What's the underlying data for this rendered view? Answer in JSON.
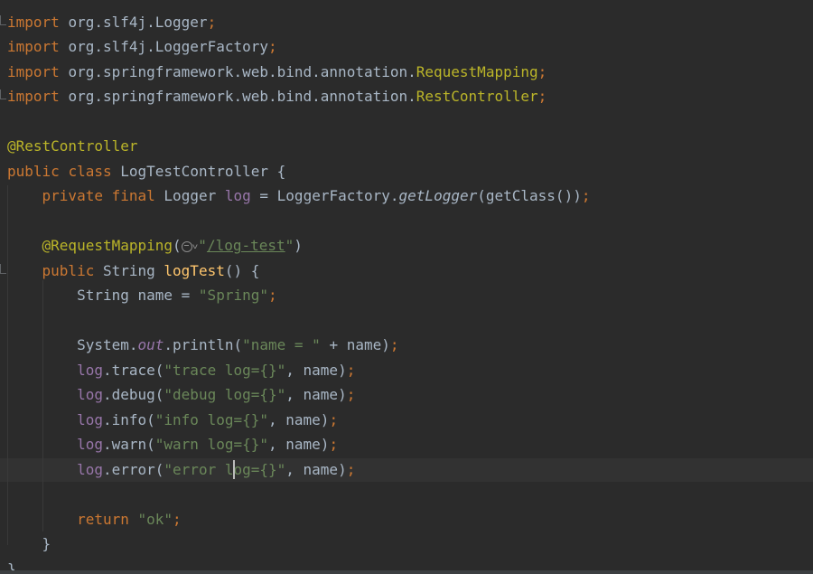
{
  "code": {
    "imports": [
      {
        "keyword": "import",
        "path": "org.slf4j.",
        "cls": "Logger",
        "semi": ";"
      },
      {
        "keyword": "import",
        "path": "org.slf4j.",
        "cls": "LoggerFactory",
        "semi": ";"
      },
      {
        "keyword": "import",
        "path": "org.springframework.web.bind.annotation.",
        "cls": "RequestMapping",
        "semi": ";"
      },
      {
        "keyword": "import",
        "path": "org.springframework.web.bind.annotation.",
        "cls": "RestController",
        "semi": ";"
      }
    ],
    "class_annotation": "@RestController",
    "class_decl": {
      "kw1": "public",
      "kw2": "class",
      "name": "LogTestController",
      "brace": " {"
    },
    "field": {
      "kw1": "private",
      "kw2": "final",
      "type": "Logger",
      "name": "log",
      "eq": " = LoggerFactory.",
      "call": "getLogger",
      "args": "(getClass())",
      "semi": ";"
    },
    "mapping": {
      "annotation": "@RequestMapping",
      "open": "(",
      "quote_open": "\"",
      "url": "/log-test",
      "quote_close": "\"",
      "close": ")"
    },
    "method_decl": {
      "kw": "public",
      "type": "String",
      "name": "logTest",
      "rest": "() {"
    },
    "name_decl": {
      "type": "String name = ",
      "value": "\"Spring\"",
      "semi": ";"
    },
    "println": {
      "prefix": "System.",
      "field": "out",
      "call": ".println(",
      "str": "\"name = \"",
      "rest": " + name)",
      "semi": ";"
    },
    "logs": [
      {
        "obj": "log",
        "call": ".trace(",
        "str": "\"trace log={}\"",
        "rest": ", name)",
        "semi": ";"
      },
      {
        "obj": "log",
        "call": ".debug(",
        "str": "\"debug log={}\"",
        "rest": ", name)",
        "semi": ";"
      },
      {
        "obj": "log",
        "call": ".info(",
        "str": "\"info log={}\"",
        "rest": ", name)",
        "semi": ";"
      },
      {
        "obj": "log",
        "call": ".warn(",
        "str": "\"warn log={}\"",
        "rest": ", name)",
        "semi": ";"
      }
    ],
    "error_log": {
      "obj": "log",
      "call": ".error(",
      "str_a": "\"error",
      "str_b": " log={}\"",
      "rest": ", name)",
      "semi": ";"
    },
    "return_stmt": {
      "kw": "return",
      "value": "\"ok\"",
      "semi": ";"
    },
    "method_close": "}",
    "class_close": "}"
  },
  "icons": [
    "web-icon",
    "chevron-down-icon"
  ]
}
